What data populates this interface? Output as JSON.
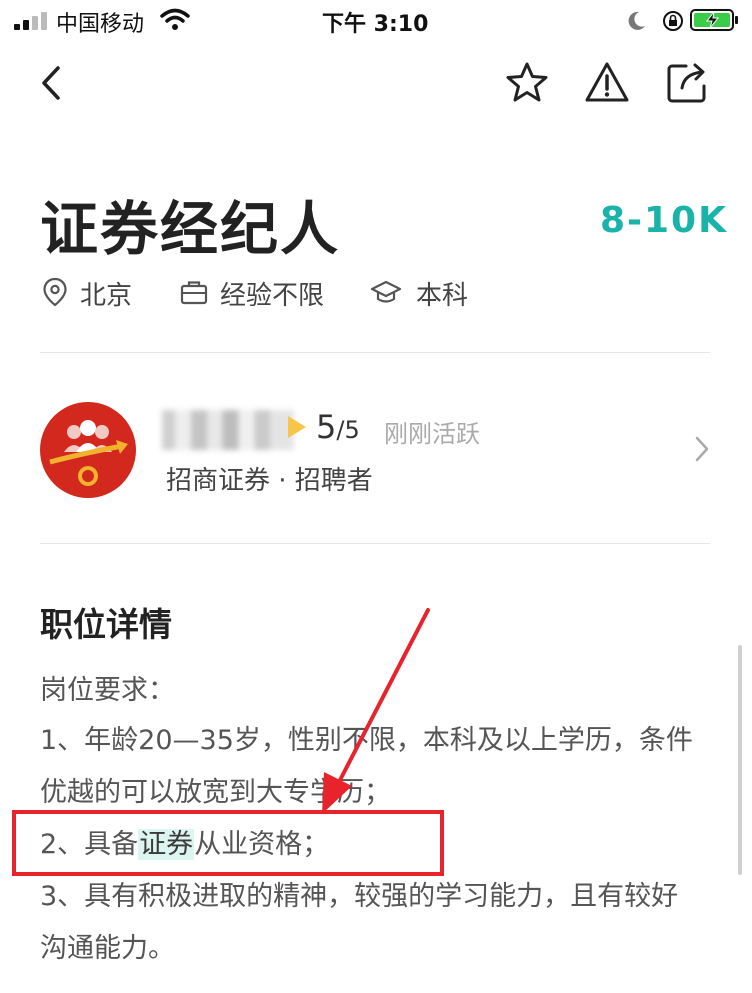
{
  "status_bar": {
    "carrier": "中国移动",
    "time": "下午 3:10"
  },
  "job": {
    "title": "证券经纪人",
    "salary": "8-10K",
    "location": "北京",
    "experience": "经验不限",
    "education": "本科"
  },
  "recruiter": {
    "rating": "5",
    "rating_total": "/5",
    "active_status": "刚刚活跃",
    "company_line": "招商证券 · 招聘者"
  },
  "details": {
    "section_title": "职位详情",
    "requirements_heading": "岗位要求：",
    "req1_line1": "1、年龄20—35岁，性别不限，本科及以上学历，条件",
    "req1_line2": "优越的可以放宽到大专学历；",
    "req2_prefix": "2、具备",
    "req2_highlight": "证券",
    "req2_suffix": "从业资格；",
    "req3_line1": "3、具有积极进取的精神，较强的学习能力，且有较好",
    "req3_line2": "沟通能力。"
  },
  "colors": {
    "accent": "#19b3aa",
    "annotation_red": "#e8232b",
    "avatar_red": "#d2281d"
  }
}
